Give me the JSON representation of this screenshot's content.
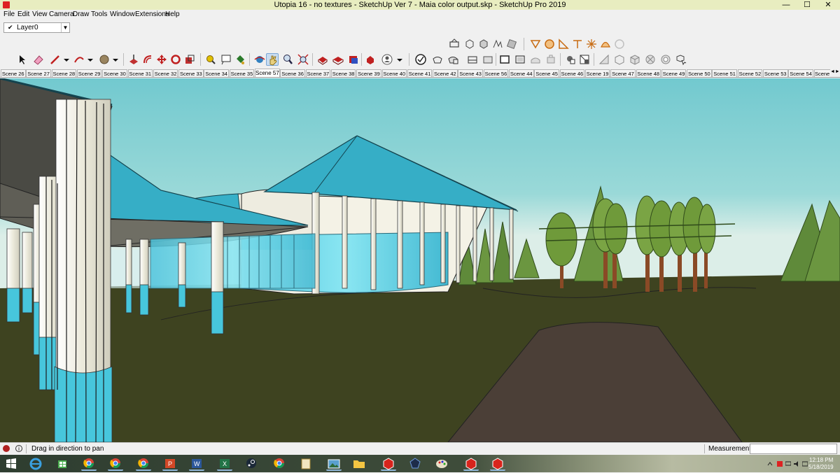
{
  "window": {
    "title": "Utopia 16 - no textures - SketchUp Ver 7 - Maia color output.skp - SketchUp Pro 2019",
    "min_glyph": "—",
    "max_glyph": "☐",
    "close_glyph": "✕"
  },
  "menu": [
    "File",
    "Edit",
    "View",
    "Camera",
    "Draw",
    "Tools",
    "Window",
    "Extensions",
    "Help"
  ],
  "layers": {
    "check": "✔",
    "current": "Layer0",
    "arrow": "▼"
  },
  "toolbars": {
    "upper": [
      "section-plane-icon",
      "display-section-planes-icon",
      "display-section-cuts-icon",
      "display-section-fill-icon",
      "xray-section-icon",
      "solid-outer-shell-icon",
      "solid-intersect-icon",
      "solid-union-icon",
      "solid-subtract-icon",
      "solid-trim-icon",
      "solid-split-icon"
    ],
    "main": [
      "select-icon",
      "eraser-icon",
      "line-icon",
      "arc-icon",
      "shapes-icon",
      "push-pull-icon",
      "offset-icon",
      "move-icon",
      "rotate-icon",
      "scale-icon",
      "tape-measure-icon",
      "text-icon",
      "paint-bucket-icon",
      "orbit-icon",
      "pan-icon",
      "zoom-icon",
      "zoom-extents-icon",
      "3d-warehouse-icon",
      "extension-warehouse-icon",
      "layout-icon",
      "extension-manager-icon",
      "account-icon",
      "xray-icon",
      "back-edges-icon",
      "wireframe-icon",
      "hidden-line-icon",
      "shaded-icon",
      "shaded-textures-icon",
      "monochrome-icon",
      "iso-view-icon",
      "top-view-icon",
      "front-view-icon",
      "right-view-icon",
      "back-view-icon",
      "left-view-icon",
      "bottom-view-icon",
      "component-icon",
      "styles-icon"
    ]
  },
  "scenes": {
    "tabs": [
      "Scene 26",
      "Scene 27",
      "Scene 28",
      "Scene 29",
      "Scene 30",
      "Scene 31",
      "Scene 32",
      "Scene 33",
      "Scene 34",
      "Scene 35",
      "Scene 57",
      "Scene 36",
      "Scene 37",
      "Scene 38",
      "Scene 39",
      "Scene 40",
      "Scene 41",
      "Scene 42",
      "Scene 43",
      "Scene 56",
      "Scene 44",
      "Scene 45",
      "Scene 46",
      "Scene 19",
      "Scene 47",
      "Scene 48",
      "Scene 49",
      "Scene 50",
      "Scene 51",
      "Scene 52",
      "Scene 53",
      "Scene 54",
      "Scene"
    ],
    "active": "Scene 57",
    "scroll_glyph": "◄►"
  },
  "viewport": {
    "sky_color": "#74cdd2",
    "horizon_color": "#d8ece6",
    "ground_color": "#3f4320",
    "path_color": "#4a3e36",
    "roof_color": "#3bb2c9",
    "glass_color": "#6ad6e8",
    "column_color": "#ecebdf",
    "tree_color": "#6f9a3a",
    "trunk_color": "#8a4a26"
  },
  "status": {
    "message": "Drag in direction to pan",
    "info_glyph": "i",
    "measurements_label": "Measurements",
    "measurements_value": ""
  },
  "taskbar": {
    "apps": [
      "windows-start-icon",
      "internet-explorer-icon",
      "windows-store-icon",
      "chrome-profile-icon",
      "chrome-icon",
      "chrome-profile-2-icon",
      "powerpoint-icon",
      "word-icon",
      "excel-icon",
      "steam-icon",
      "chrome-3-icon",
      "file-explorer-doc-icon",
      "photos-icon",
      "file-explorer-icon",
      "sketchup-icon",
      "lightroom-icon",
      "paint-icon",
      "sketchup-2-icon",
      "sketchup-3-icon"
    ],
    "time": "12:18 PM",
    "date": "5/18/2019"
  }
}
